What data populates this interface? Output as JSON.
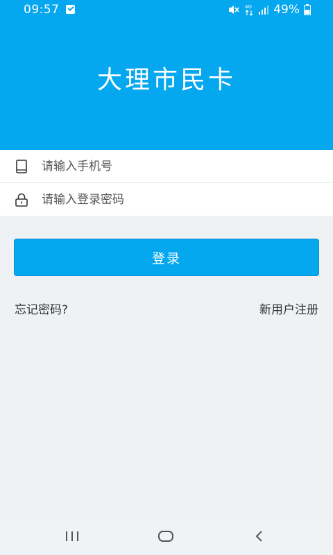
{
  "status_bar": {
    "time": "09:57",
    "battery": "49%",
    "icons": [
      "notification-check-icon",
      "mute-icon",
      "4g-icon",
      "signal-icon",
      "battery-icon"
    ]
  },
  "app": {
    "title": "大理市民卡",
    "accent_color": "#05a7ef"
  },
  "form": {
    "phone_placeholder": "请输入手机号",
    "password_placeholder": "请输入登录密码"
  },
  "actions": {
    "login_label": "登录",
    "forgot_label": "忘记密码?",
    "register_label": "新用户注册"
  },
  "nav": {
    "icons": [
      "recent-apps-icon",
      "home-icon",
      "back-icon"
    ]
  }
}
